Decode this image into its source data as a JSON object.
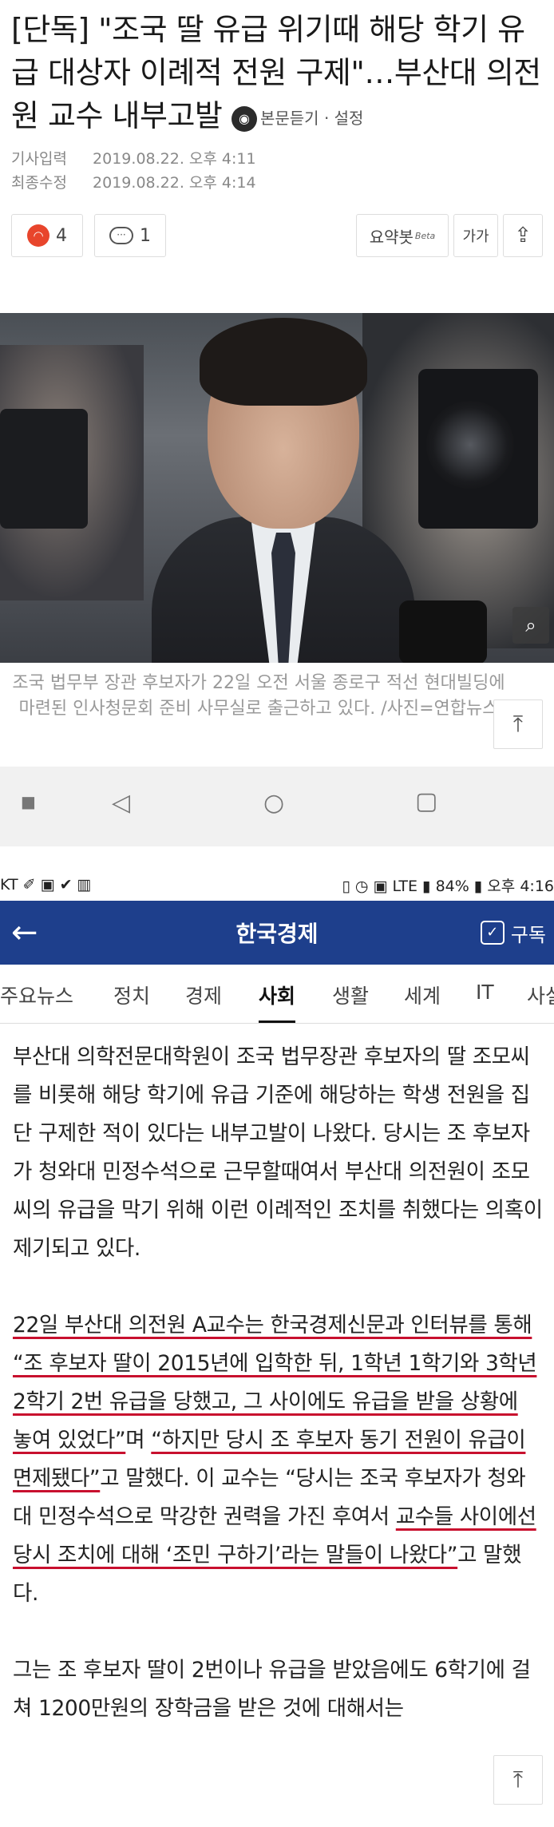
{
  "article_top": {
    "headline": "[단독] \"조국 딸 유급 위기때 해당 학기 유급 대상자 이례적 전원 구제\"…부산대 의전원 교수 내부고발",
    "listen_label": "본문듣기 · 설정",
    "meta": [
      {
        "label": "기사입력",
        "value": "2019.08.22. 오후 4:11"
      },
      {
        "label": "최종수정",
        "value": "2019.08.22. 오후 4:14"
      }
    ],
    "reaction_count": "4",
    "comment_count": "1",
    "summary_label": "요약봇",
    "summary_badge": "Beta",
    "fontsize_label": "가가",
    "caption": "조국 법무부 장관 후보자가 22일 오전 서울 종로구 적선 현대빌딩에 마련된 인사청문회 준비 사무실로 출근하고 있다. /사진=연합뉴스"
  },
  "statusbar": {
    "left": "KT ✐ ▣ ✔ ▥",
    "right": "▯ ◷ ▣ LTE ▮ 84% ▮ 오후 4:16"
  },
  "appbar": {
    "title": "한국경제",
    "subscribe_label": "구독"
  },
  "tabs": [
    {
      "label": "주요뉴스"
    },
    {
      "label": "정치"
    },
    {
      "label": "경제"
    },
    {
      "label": "사회"
    },
    {
      "label": "생활"
    },
    {
      "label": "세계"
    },
    {
      "label": "IT"
    },
    {
      "label": "사설"
    }
  ],
  "article": {
    "p1": "부산대 의학전문대학원이 조국 법무장관 후보자의 딸 조모씨를 비롯해 해당 학기에 유급 기준에 해당하는 학생 전원을 집단 구제한 적이 있다는 내부고발이 나왔다. 당시는 조 후보자가 청와대 민정수석으로 근무할때여서 부산대 의전원이 조모씨의 유급을 막기 위해 이런 이례적인 조치를 취했다는 의혹이 제기되고 있다.",
    "p2_a": "22일 부산대 의전원 A교수는 한국경제신문과 인터뷰를 통해 “조 후보자 딸이 2015년에 입학한 뒤, 1학년 1학기와 3학년 2학기 2번 유급을 당했고, 그 사이에도 유급을 받을 상황에 놓여 있었다”",
    "p2_b": "며 ",
    "p2_c": "“하지만 당시 조 후보자 동기 전원이 유급이 면제됐다”",
    "p2_d": "고 말했다. 이 교수는 “당시는 조국 후보자가 청와대 민정수석으로 막강한 권력을 가진 후여서 ",
    "p2_e": "교수들 사이에선 당시 조치에 대해 ‘조민 구하기’라는 말들이 나왔다”",
    "p2_f": "고 말했다.",
    "p3": "그는 조 후보자 딸이 2번이나 유급을 받았음에도 6학기에 걸쳐 1200만원의 장학금을 받은 것에 대해서는"
  }
}
